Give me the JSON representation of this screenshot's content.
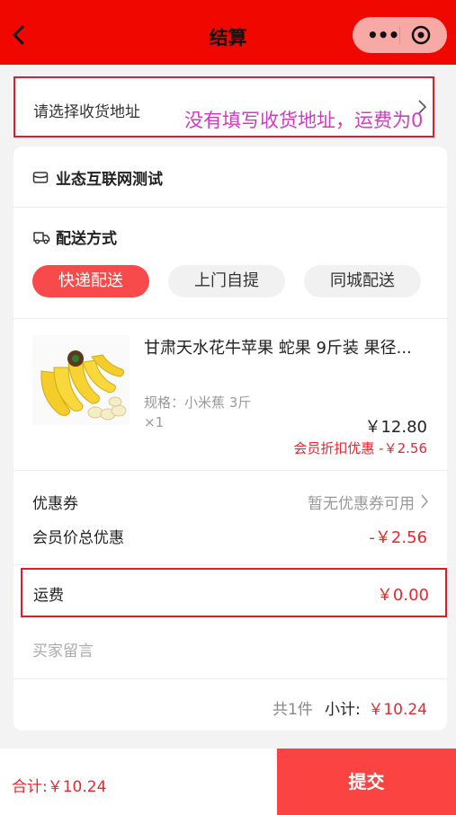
{
  "nav": {
    "title": "结算",
    "capsule_dots": "•••"
  },
  "address": {
    "placeholder": "请选择收货地址"
  },
  "annotation": "没有填写收货地址，运费为0",
  "store": {
    "name": "业态互联网测试"
  },
  "shipping": {
    "title": "配送方式",
    "options": [
      "快递配送",
      "上门自提",
      "同城配送"
    ],
    "selected": "快递配送"
  },
  "product": {
    "name": "甘肃天水花牛苹果 蛇果 9斤装 果径...",
    "spec": "规格：小米蕉 3斤",
    "qty": "×1",
    "price": "￥12.80",
    "member_discount": "会员折扣优惠 -￥2.56"
  },
  "coupon": {
    "label": "优惠券",
    "value": "暂无优惠券可用"
  },
  "member_total": {
    "label": "会员价总优惠",
    "value": "-￥2.56"
  },
  "freight": {
    "label": "运费",
    "value": "￥0.00"
  },
  "remark": {
    "placeholder": "买家留言"
  },
  "summary": {
    "count": "共1件",
    "subtotal_label": "小计:",
    "subtotal_value": "￥10.24"
  },
  "bottom": {
    "total": "合计:￥10.24",
    "submit_label": "提交"
  },
  "colors": {
    "nav_bg": "#f00800",
    "accent": "#f84a4a",
    "price_red": "#e8262e",
    "annotation": "#d03bbf",
    "highlight_border": "#e01b2a"
  }
}
